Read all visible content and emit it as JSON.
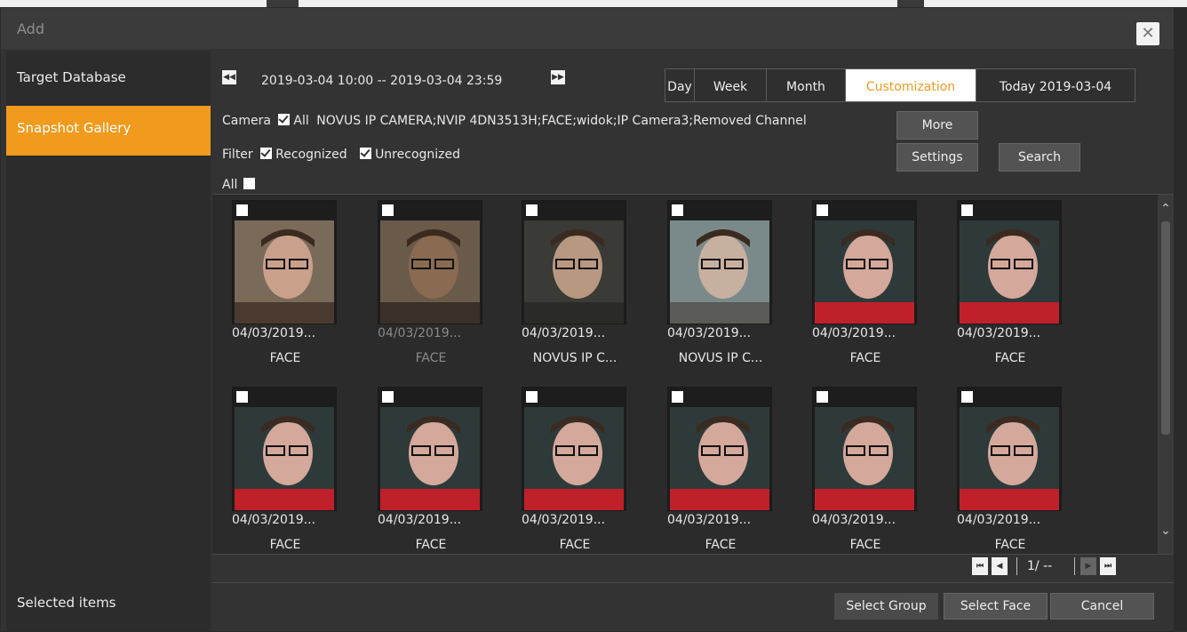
{
  "dialog": {
    "title": "Add",
    "close_label": "✕"
  },
  "sidebar": {
    "items": [
      {
        "label": "Target Database"
      },
      {
        "label": "Snapshot Gallery"
      }
    ],
    "selected_items_label": "Selected items"
  },
  "toolbar": {
    "prev_label": "◀◀",
    "next_label": "▶▶",
    "date_range": "2019-03-04 10:00 -- 2019-03-04 23:59",
    "tabs": [
      {
        "label": "Day"
      },
      {
        "label": "Week"
      },
      {
        "label": "Month"
      },
      {
        "label": "Customization"
      },
      {
        "label": "Today 2019-03-04"
      }
    ],
    "active_tab": "Customization",
    "camera_label": "Camera",
    "camera_all_label": "All",
    "camera_list": "NOVUS IP CAMERA;NVIP 4DN3513H;FACE;widok;IP Camera3;Removed Channel",
    "filter_label": "Filter",
    "filter_recognized": "Recognized",
    "filter_unrecognized": "Unrecognized",
    "all_label": "All",
    "more_label": "More",
    "settings_label": "Settings",
    "search_label": "Search"
  },
  "gallery": {
    "items": [
      {
        "date": "04/03/2019...",
        "name": "FACE"
      },
      {
        "date": "04/03/2019...",
        "name": "FACE"
      },
      {
        "date": "04/03/2019...",
        "name": "NOVUS IP C..."
      },
      {
        "date": "04/03/2019...",
        "name": "NOVUS IP C..."
      },
      {
        "date": "04/03/2019...",
        "name": "FACE"
      },
      {
        "date": "04/03/2019...",
        "name": "FACE"
      },
      {
        "date": "04/03/2019...",
        "name": "FACE"
      },
      {
        "date": "04/03/2019...",
        "name": "FACE"
      },
      {
        "date": "04/03/2019...",
        "name": "FACE"
      },
      {
        "date": "04/03/2019...",
        "name": "FACE"
      },
      {
        "date": "04/03/2019...",
        "name": "FACE"
      },
      {
        "date": "04/03/2019...",
        "name": "FACE"
      }
    ]
  },
  "pager": {
    "first": "⏮",
    "prev": "◀",
    "page_label": "1/ --",
    "next": "▶",
    "last": "⏭"
  },
  "footer": {
    "select_group_label": "Select Group",
    "select_face_label": "Select Face",
    "cancel_label": "Cancel"
  },
  "colors": {
    "accent": "#f09a1e",
    "background": "#333333",
    "sidebar": "#2c2c2c"
  }
}
